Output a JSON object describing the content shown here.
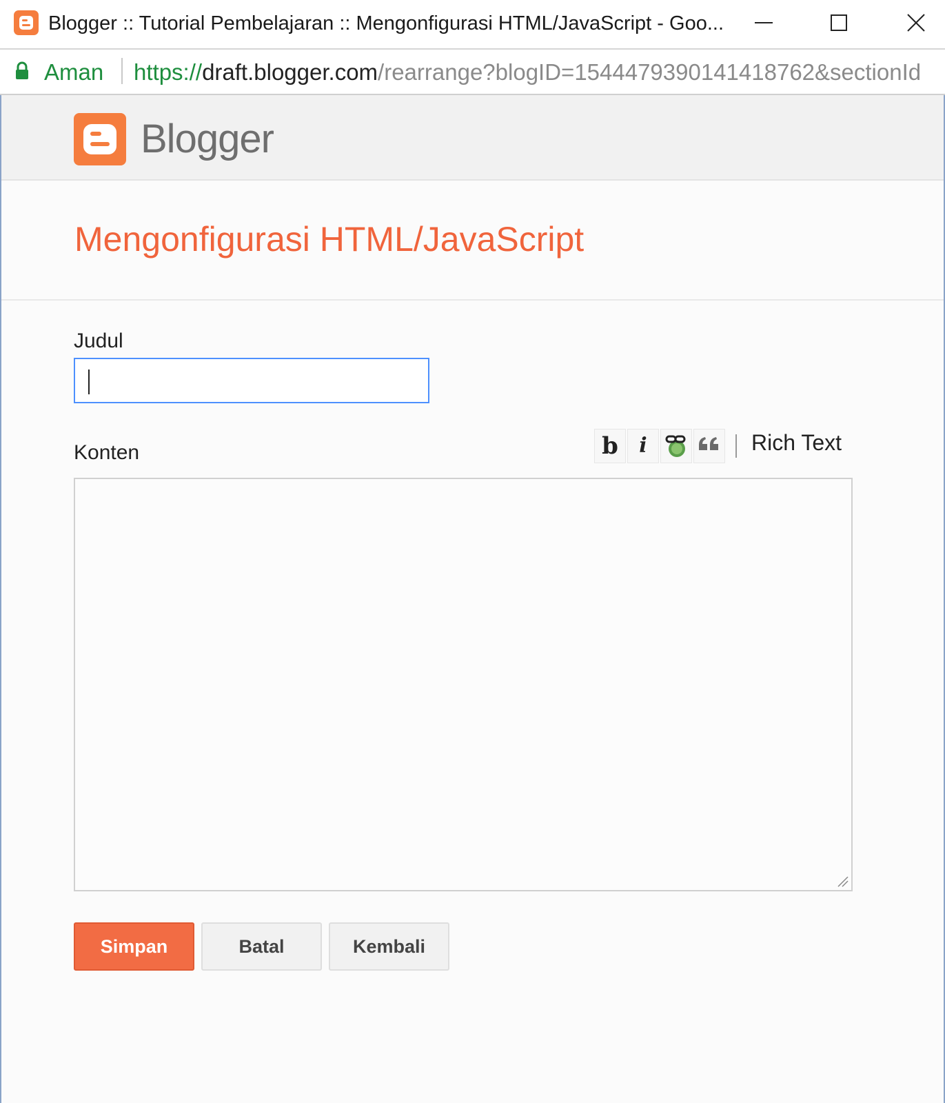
{
  "window": {
    "title": "Blogger :: Tutorial Pembelajaran :: Mengonfigurasi HTML/JavaScript - Goo...",
    "controls": [
      "minimize",
      "maximize",
      "close"
    ]
  },
  "address_bar": {
    "security_label": "Aman",
    "url_scheme": "https://",
    "url_host": "draft.blogger.com",
    "url_path": "/rearrange?blogID=1544479390141418762&sectionId",
    "secure_color": "#1e8e3e"
  },
  "header": {
    "brand": "Blogger",
    "brand_color": "#f57d3e"
  },
  "page": {
    "title": "Mengonfigurasi HTML/JavaScript",
    "title_color": "#f0643c"
  },
  "form": {
    "title_label": "Judul",
    "title_value": "",
    "content_label": "Konten",
    "content_value": "",
    "toolbar": {
      "bold_label": "b",
      "italic_label": "i",
      "link_icon": "link-icon",
      "quote_icon": "quote-icon",
      "rich_text_label": "Rich Text"
    }
  },
  "actions": {
    "save_label": "Simpan",
    "cancel_label": "Batal",
    "back_label": "Kembali",
    "save_color": "#f26c44"
  }
}
